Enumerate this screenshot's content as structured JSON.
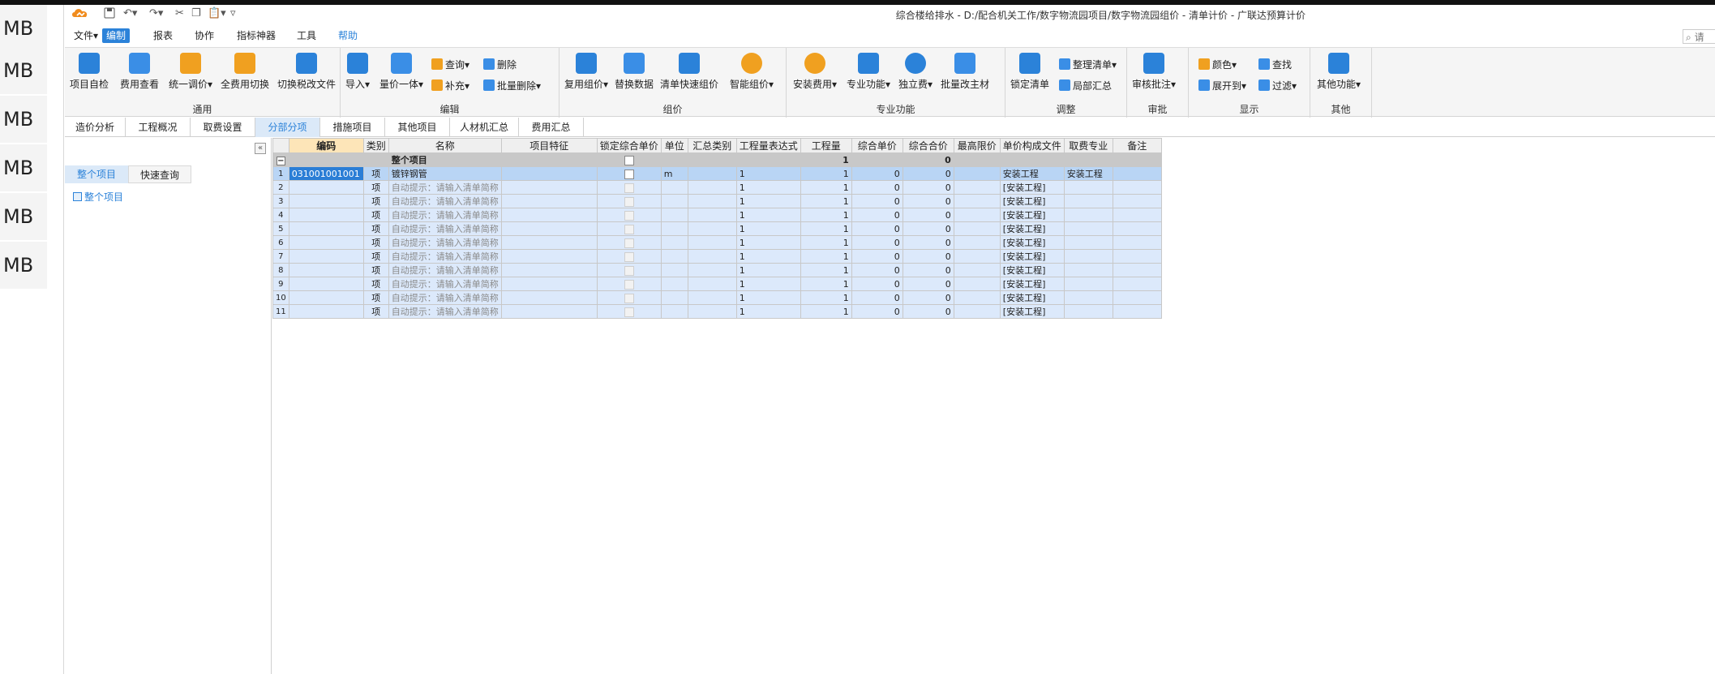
{
  "side_labels": [
    "MB",
    "MB",
    "MB",
    "MB",
    "MB",
    "MB"
  ],
  "window_title": "综合楼给排水 - D:/配合机关工作/数字物流园项目/数字物流园组价 - 清单计价 - 广联达预算计价",
  "menu": [
    "文件▾",
    "编制",
    "报表",
    "协作",
    "指标神器",
    "工具",
    "帮助"
  ],
  "search_placeholder": "请",
  "ribbon": {
    "general": {
      "label": "通用",
      "buttons": [
        "项目自检",
        "费用查看",
        "统一调价▾",
        "全费用切换",
        "切换税改文件"
      ]
    },
    "edit": {
      "label": "编辑",
      "buttons": [
        "导入▾",
        "量价一体▾"
      ],
      "small": [
        "查询▾",
        "补充▾",
        "删除",
        "批量删除▾"
      ]
    },
    "pricing": {
      "label": "组价",
      "buttons": [
        "复用组价▾",
        "替换数据",
        "清单快速组价",
        "智能组价▾"
      ]
    },
    "special": {
      "label": "专业功能",
      "buttons": [
        "安装费用▾",
        "专业功能▾",
        "独立费▾",
        "批量改主材"
      ]
    },
    "adjust": {
      "label": "调整",
      "buttons": [
        "锁定清单"
      ],
      "small": [
        "整理清单▾",
        "局部汇总"
      ]
    },
    "review": {
      "label": "审批",
      "buttons": [
        "审核批注▾"
      ]
    },
    "display": {
      "label": "显示",
      "small": [
        "颜色▾",
        "查找",
        "展开到▾",
        "过滤▾"
      ]
    },
    "other": {
      "label": "其他",
      "buttons": [
        "其他功能▾"
      ]
    }
  },
  "tabs": [
    "造价分析",
    "工程概况",
    "取费设置",
    "分部分项",
    "措施项目",
    "其他项目",
    "人材机汇总",
    "费用汇总"
  ],
  "active_tab": "分部分项",
  "left_panel": {
    "tabs": [
      "整个项目",
      "快速查询"
    ],
    "tree_item": "整个项目"
  },
  "grid": {
    "columns": [
      "编码",
      "类别",
      "名称",
      "项目特征",
      "锁定综合单价",
      "单位",
      "汇总类别",
      "工程量表达式",
      "工程量",
      "综合单价",
      "综合合价",
      "最高限价",
      "单价构成文件",
      "取费专业",
      "备注"
    ],
    "summary": {
      "name": "整个项目",
      "quantity": "1",
      "total": "0"
    },
    "rows": [
      {
        "no": "1",
        "code": "031001001001",
        "type": "项",
        "name": "镀锌钢管",
        "unit": "m",
        "expr": "1",
        "qty": "1",
        "price": "0",
        "total": "0",
        "file": "安装工程",
        "spec": "安装工程"
      },
      {
        "no": "2",
        "code": "",
        "type": "项",
        "name": "自动提示：请输入清单简称",
        "unit": "",
        "expr": "1",
        "qty": "1",
        "price": "0",
        "total": "0",
        "file": "[安装工程]",
        "spec": ""
      },
      {
        "no": "3",
        "code": "",
        "type": "项",
        "name": "自动提示：请输入清单简称",
        "unit": "",
        "expr": "1",
        "qty": "1",
        "price": "0",
        "total": "0",
        "file": "[安装工程]",
        "spec": ""
      },
      {
        "no": "4",
        "code": "",
        "type": "项",
        "name": "自动提示：请输入清单简称",
        "unit": "",
        "expr": "1",
        "qty": "1",
        "price": "0",
        "total": "0",
        "file": "[安装工程]",
        "spec": ""
      },
      {
        "no": "5",
        "code": "",
        "type": "项",
        "name": "自动提示：请输入清单简称",
        "unit": "",
        "expr": "1",
        "qty": "1",
        "price": "0",
        "total": "0",
        "file": "[安装工程]",
        "spec": ""
      },
      {
        "no": "6",
        "code": "",
        "type": "项",
        "name": "自动提示：请输入清单简称",
        "unit": "",
        "expr": "1",
        "qty": "1",
        "price": "0",
        "total": "0",
        "file": "[安装工程]",
        "spec": ""
      },
      {
        "no": "7",
        "code": "",
        "type": "项",
        "name": "自动提示：请输入清单简称",
        "unit": "",
        "expr": "1",
        "qty": "1",
        "price": "0",
        "total": "0",
        "file": "[安装工程]",
        "spec": ""
      },
      {
        "no": "8",
        "code": "",
        "type": "项",
        "name": "自动提示：请输入清单简称",
        "unit": "",
        "expr": "1",
        "qty": "1",
        "price": "0",
        "total": "0",
        "file": "[安装工程]",
        "spec": ""
      },
      {
        "no": "9",
        "code": "",
        "type": "项",
        "name": "自动提示：请输入清单简称",
        "unit": "",
        "expr": "1",
        "qty": "1",
        "price": "0",
        "total": "0",
        "file": "[安装工程]",
        "spec": ""
      },
      {
        "no": "10",
        "code": "",
        "type": "项",
        "name": "自动提示：请输入清单简称",
        "unit": "",
        "expr": "1",
        "qty": "1",
        "price": "0",
        "total": "0",
        "file": "[安装工程]",
        "spec": ""
      },
      {
        "no": "11",
        "code": "",
        "type": "项",
        "name": "自动提示：请输入清单简称",
        "unit": "",
        "expr": "1",
        "qty": "1",
        "price": "0",
        "total": "0",
        "file": "[安装工程]",
        "spec": ""
      }
    ]
  },
  "colors": {
    "accent": "#2b82d9",
    "row_bg": "#dce9fb",
    "selected_row": "#b9d5f5",
    "summary_bg": "#c8c8c8",
    "header_selected": "#fde5b8"
  },
  "icons": [
    "logo-icon",
    "save-icon",
    "undo-icon",
    "redo-icon",
    "cut-icon",
    "copy-icon",
    "paste-icon",
    "customize-icon",
    "search-icon"
  ]
}
